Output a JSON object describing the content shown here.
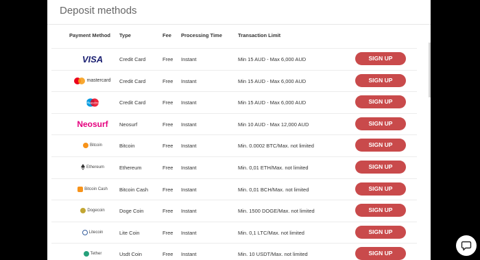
{
  "heading": "Deposit methods",
  "columns": [
    "Payment Method",
    "Type",
    "Fee",
    "Processing Time",
    "Transaction Limit"
  ],
  "rows": [
    {
      "logo": "VISA",
      "type": "Credit Card",
      "fee": "Free",
      "time": "Instant",
      "limit": "Min 15 AUD - Max 6,000 AUD",
      "button": "SIGN UP"
    },
    {
      "logo": "mastercard",
      "type": "Credit Card",
      "fee": "Free",
      "time": "Instant",
      "limit": "Min 15 AUD - Max 6,000 AUD",
      "button": "SIGN UP"
    },
    {
      "logo": "Maestro",
      "type": "Credit Card",
      "fee": "Free",
      "time": "Instant",
      "limit": "Min 15 AUD - Max 6,000 AUD",
      "button": "SIGN UP"
    },
    {
      "logo": "Neosurf",
      "type": "Neosurf",
      "fee": "Free",
      "time": "Instant",
      "limit": "Min 10 AUD - Max 12,000 AUD",
      "button": "SIGN UP"
    },
    {
      "logo": "Bitcoin",
      "type": "Bitcoin",
      "fee": "Free",
      "time": "Instant",
      "limit": "Min. 0.0002 BTC/Max. not limited",
      "button": "SIGN UP"
    },
    {
      "logo": "Ethereum",
      "type": "Ethereum",
      "fee": "Free",
      "time": "Instant",
      "limit": "Min. 0,01 ETH/Max. not limited",
      "button": "SIGN UP"
    },
    {
      "logo": "Bitcoin Cash",
      "type": "Bitcoin Cash",
      "fee": "Free",
      "time": "Instant",
      "limit": "Min. 0,01 BCH/Max. not limited",
      "button": "SIGN UP"
    },
    {
      "logo": "Dogecoin",
      "type": "Doge Coin",
      "fee": "Free",
      "time": "Instant",
      "limit": "Min. 1500 DOGE/Max. not limited",
      "button": "SIGN UP"
    },
    {
      "logo": "Litecoin",
      "type": "Lite Coin",
      "fee": "Free",
      "time": "Instant",
      "limit": "Min. 0,1 LTC/Max. not limited",
      "button": "SIGN UP"
    },
    {
      "logo": "Tether",
      "type": "Usdt Coin",
      "fee": "Free",
      "time": "Instant",
      "limit": "Min. 10 USDT/Max. not limited",
      "button": "SIGN UP"
    }
  ],
  "colors": {
    "button": "#c94a4b",
    "visa": "#1a1f71",
    "neosurf": "#e5007e"
  },
  "icons": {
    "chat": "chat-bubble-icon"
  }
}
